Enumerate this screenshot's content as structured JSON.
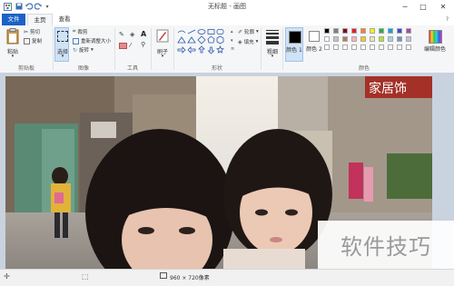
{
  "window": {
    "title": "无标题 - 画图",
    "quick_access": [
      "save-icon",
      "undo-icon",
      "redo-icon",
      "customize-icon"
    ],
    "controls": {
      "minimize": "─",
      "maximize": "□",
      "close": "✕"
    }
  },
  "tabs": [
    {
      "label": "文件",
      "active": false
    },
    {
      "label": "主页",
      "active": true
    },
    {
      "label": "查看",
      "active": false
    }
  ],
  "ribbon": {
    "clipboard": {
      "label": "剪贴板",
      "paste": "粘贴",
      "cut": "剪切",
      "copy": "复制"
    },
    "image": {
      "label": "图像",
      "select": "选择",
      "crop": "裁剪",
      "resize": "重新调整大小",
      "rotate": "旋转"
    },
    "tools": {
      "label": "工具",
      "items": [
        "pencil-icon",
        "fill-icon",
        "text-icon",
        "eraser-icon",
        "color-picker-icon",
        "magnifier-icon"
      ],
      "text_glyph": "A"
    },
    "brushes": {
      "label": "刷子"
    },
    "shapes": {
      "label": "形状",
      "outline": "轮廓",
      "fill": "填充"
    },
    "size": {
      "label": "粗细"
    },
    "colors": {
      "label": "颜色",
      "color1": "颜色 1",
      "color2": "颜色 2",
      "edit": "编辑颜色",
      "color1_value": "#000000",
      "color2_value": "#ffffff",
      "palette_row1": [
        "#000000",
        "#7f7f7f",
        "#880015",
        "#ed1c24",
        "#ff7f27",
        "#fff200",
        "#22b14c",
        "#00a2e8",
        "#3f48cc",
        "#a349a4"
      ],
      "palette_row2": [
        "#ffffff",
        "#c3c3c3",
        "#b97a57",
        "#ffaec9",
        "#ffc90e",
        "#efe4b0",
        "#b5e61d",
        "#99d9ea",
        "#7092be",
        "#c8bfe7"
      ],
      "palette_row3": [
        "#ffffff",
        "#ffffff",
        "#ffffff",
        "#ffffff",
        "#ffffff",
        "#ffffff",
        "#ffffff",
        "#ffffff",
        "#ffffff",
        "#ffffff"
      ]
    }
  },
  "canvas": {
    "content": "photo",
    "shop_sign": "家居饰"
  },
  "status": {
    "image_size": "960 × 720像素",
    "watermark": "软件技巧"
  }
}
